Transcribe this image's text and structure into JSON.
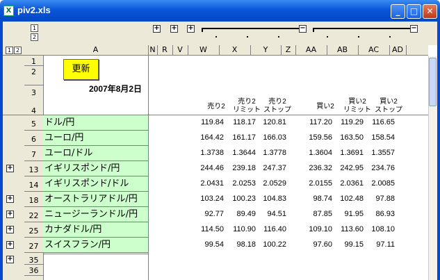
{
  "window": {
    "title": "piv2.xls",
    "min": "_",
    "max": "□",
    "close": "✕"
  },
  "outline": {
    "row_levels": [
      "1",
      "2"
    ],
    "col_levels": [
      "1",
      "2"
    ]
  },
  "columns": [
    "A",
    "N",
    "R",
    "V",
    "W",
    "X",
    "Y",
    "Z",
    "AA",
    "AB",
    "AC",
    "AD"
  ],
  "header_rows": [
    "1",
    "2",
    "3",
    "4"
  ],
  "refresh_label": "更新",
  "date": "2007年8月2日",
  "col_headers": {
    "sell2": "売り2",
    "sell2_limit": "売り2\nリミット",
    "sell2_stop": "売り2\nストップ",
    "buy2": "買い2",
    "buy2_limit": "買い2\nリミット",
    "buy2_stop": "買い2\nストップ"
  },
  "rows": [
    {
      "rownum": "5",
      "label": "ドル/円",
      "v": [
        "119.84",
        "118.17",
        "120.81",
        "117.20",
        "119.29",
        "116.65"
      ],
      "plus": false
    },
    {
      "rownum": "6",
      "label": "ユーロ/円",
      "v": [
        "164.42",
        "161.17",
        "166.03",
        "159.56",
        "163.50",
        "158.54"
      ],
      "plus": false
    },
    {
      "rownum": "7",
      "label": "ユーロ/ドル",
      "v": [
        "1.3738",
        "1.3644",
        "1.3778",
        "1.3604",
        "1.3691",
        "1.3557"
      ],
      "plus": false
    },
    {
      "rownum": "13",
      "label": "イギリスポンド/円",
      "v": [
        "244.46",
        "239.18",
        "247.37",
        "236.32",
        "242.95",
        "234.76"
      ],
      "plus": true
    },
    {
      "rownum": "14",
      "label": "イギリスポンド/ドル",
      "v": [
        "2.0431",
        "2.0253",
        "2.0529",
        "2.0155",
        "2.0361",
        "2.0085"
      ],
      "plus": false
    },
    {
      "rownum": "18",
      "label": "オーストラリアドル/円",
      "v": [
        "103.24",
        "100.23",
        "104.83",
        "98.74",
        "102.48",
        "97.88"
      ],
      "plus": true
    },
    {
      "rownum": "22",
      "label": "ニュージーランドル/円",
      "v": [
        "92.77",
        "89.49",
        "94.51",
        "87.85",
        "91.95",
        "86.93"
      ],
      "plus": true
    },
    {
      "rownum": "25",
      "label": "カナダドル/円",
      "v": [
        "114.50",
        "110.90",
        "116.40",
        "109.10",
        "113.60",
        "108.10"
      ],
      "plus": true
    },
    {
      "rownum": "27",
      "label": "スイスフラン/円",
      "v": [
        "99.54",
        "98.18",
        "100.22",
        "97.60",
        "99.15",
        "97.11"
      ],
      "plus": true
    }
  ],
  "trailing_rows": [
    "35",
    "36"
  ]
}
